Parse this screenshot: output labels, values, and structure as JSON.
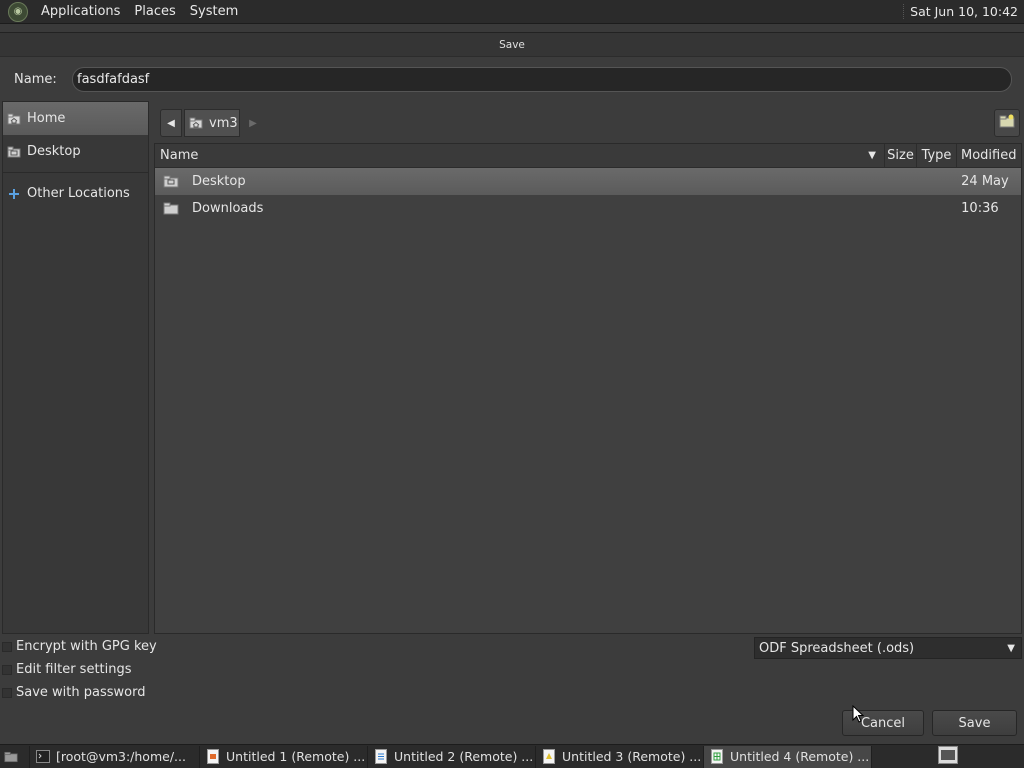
{
  "top_panel": {
    "menus": [
      "Applications",
      "Places",
      "System"
    ],
    "clock": "Sat Jun 10, 10:42"
  },
  "dialog": {
    "title": "Save",
    "name_label": "Name:",
    "name_value": "fasdfafdasf"
  },
  "sidebar": {
    "items": [
      {
        "label": "Home",
        "icon": "home-folder-icon",
        "active": true
      },
      {
        "label": "Desktop",
        "icon": "desktop-folder-icon",
        "active": false
      },
      {
        "label": "Other Locations",
        "icon": "plus-icon",
        "active": false
      }
    ]
  },
  "pathbar": {
    "current": "vm3"
  },
  "file_list": {
    "columns": [
      "Name",
      "Size",
      "Type",
      "Modified"
    ],
    "rows": [
      {
        "name": "Desktop",
        "size": "",
        "type": "",
        "modified": "24 May",
        "selected": true
      },
      {
        "name": "Downloads",
        "size": "",
        "type": "",
        "modified": "10:36",
        "selected": false
      }
    ]
  },
  "options": {
    "checkboxes": [
      "Encrypt with GPG key",
      "Edit filter settings",
      "Save with password"
    ],
    "file_type": "ODF Spreadsheet (.ods)"
  },
  "buttons": {
    "cancel": "Cancel",
    "save": "Save"
  },
  "taskbar": {
    "tasks": [
      {
        "label": "[root@vm3:/home/...",
        "icon": "terminal-icon",
        "active": false
      },
      {
        "label": "Untitled 1 (Remote) ...",
        "icon": "impress-icon",
        "active": false
      },
      {
        "label": "Untitled 2 (Remote) ...",
        "icon": "writer-icon",
        "active": false
      },
      {
        "label": "Untitled 3 (Remote) ...",
        "icon": "draw-icon",
        "active": false
      },
      {
        "label": "Untitled 4 (Remote) ...",
        "icon": "calc-icon",
        "active": true
      }
    ]
  },
  "colors": {
    "panel_bg": "#2b2b2b",
    "dialog_bg": "#3c3c3c",
    "selection": "#5e5e5e"
  }
}
